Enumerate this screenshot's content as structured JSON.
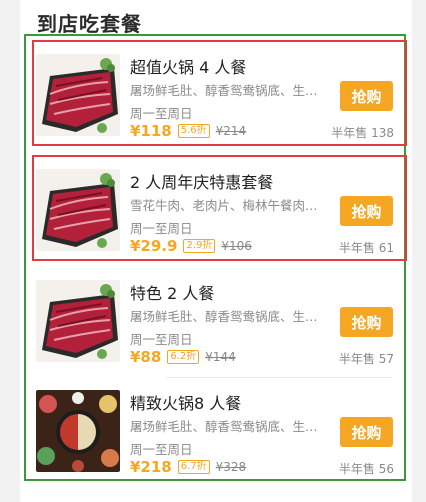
{
  "section": {
    "title": "到店吃套餐"
  },
  "colors": {
    "accent": "#f5a623",
    "highlight_red": "#e23b3b",
    "frame_green": "#3a9a3a"
  },
  "items": [
    {
      "name": "超值火锅 4 人餐",
      "desc": "屠场鲜毛肚、醇香鸳鸯锅底、生…",
      "availability": "周一至周日",
      "price": "¥118",
      "discount": "5.6折",
      "original": "¥214",
      "button": "抢购",
      "sold": "半年售 138",
      "image": "beef-slices-photo"
    },
    {
      "name": "2 人周年庆特惠套餐",
      "desc": "雪花牛肉、老肉片、梅林午餐肉…",
      "availability": "周一至周日",
      "price": "¥29.9",
      "discount": "2.9折",
      "original": "¥106",
      "button": "抢购",
      "sold": "半年售 61",
      "image": "beef-slices-photo"
    },
    {
      "name": "特色 2 人餐",
      "desc": "屠场鲜毛肚、醇香鸳鸯锅底、生…",
      "availability": "周一至周日",
      "price": "¥88",
      "discount": "6.2折",
      "original": "¥144",
      "button": "抢购",
      "sold": "半年售 57",
      "image": "beef-slices-photo"
    },
    {
      "name": "精致火锅8 人餐",
      "desc": "屠场鲜毛肚、醇香鸳鸯锅底、生…",
      "availability": "周一至周日",
      "price": "¥218",
      "discount": "6.7折",
      "original": "¥328",
      "button": "抢购",
      "sold": "半年售 56",
      "image": "hotpot-table-photo"
    }
  ]
}
